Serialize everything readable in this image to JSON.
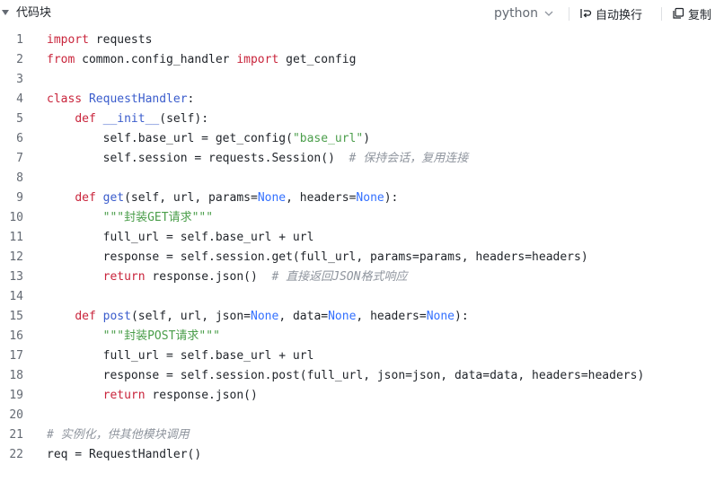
{
  "header": {
    "title": "代码块",
    "language": "python",
    "wrap_label": "自动换行",
    "copy_label": "复制"
  },
  "code": {
    "lines": [
      {
        "num": "1",
        "tokens": [
          {
            "t": "import",
            "c": "kw"
          },
          {
            "t": " requests",
            "c": ""
          }
        ]
      },
      {
        "num": "2",
        "tokens": [
          {
            "t": "from",
            "c": "kw"
          },
          {
            "t": " common.config_handler ",
            "c": ""
          },
          {
            "t": "import",
            "c": "kw"
          },
          {
            "t": " get_config",
            "c": ""
          }
        ]
      },
      {
        "num": "3",
        "tokens": []
      },
      {
        "num": "4",
        "tokens": [
          {
            "t": "class",
            "c": "kw"
          },
          {
            "t": " ",
            "c": ""
          },
          {
            "t": "RequestHandler",
            "c": "def"
          },
          {
            "t": ":",
            "c": ""
          }
        ]
      },
      {
        "num": "5",
        "tokens": [
          {
            "t": "    ",
            "c": ""
          },
          {
            "t": "def",
            "c": "kw"
          },
          {
            "t": " ",
            "c": ""
          },
          {
            "t": "__init__",
            "c": "def"
          },
          {
            "t": "(self):",
            "c": ""
          }
        ]
      },
      {
        "num": "6",
        "tokens": [
          {
            "t": "        self.base_url = get_config(",
            "c": ""
          },
          {
            "t": "\"base_url\"",
            "c": "str"
          },
          {
            "t": ")",
            "c": ""
          }
        ]
      },
      {
        "num": "7",
        "tokens": [
          {
            "t": "        self.session = requests.Session()  ",
            "c": ""
          },
          {
            "t": "# 保持会话，复用连接",
            "c": "cmt"
          }
        ]
      },
      {
        "num": "8",
        "tokens": []
      },
      {
        "num": "9",
        "tokens": [
          {
            "t": "    ",
            "c": ""
          },
          {
            "t": "def",
            "c": "kw"
          },
          {
            "t": " ",
            "c": ""
          },
          {
            "t": "get",
            "c": "def"
          },
          {
            "t": "(self, url, params=",
            "c": ""
          },
          {
            "t": "None",
            "c": "kwb"
          },
          {
            "t": ", headers=",
            "c": ""
          },
          {
            "t": "None",
            "c": "kwb"
          },
          {
            "t": "):",
            "c": ""
          }
        ]
      },
      {
        "num": "10",
        "tokens": [
          {
            "t": "        ",
            "c": ""
          },
          {
            "t": "\"\"\"封装GET请求\"\"\"",
            "c": "str"
          }
        ]
      },
      {
        "num": "11",
        "tokens": [
          {
            "t": "        full_url = self.base_url + url",
            "c": ""
          }
        ]
      },
      {
        "num": "12",
        "tokens": [
          {
            "t": "        response = self.session.get(full_url, params=params, headers=headers)",
            "c": ""
          }
        ]
      },
      {
        "num": "13",
        "tokens": [
          {
            "t": "        ",
            "c": ""
          },
          {
            "t": "return",
            "c": "kw"
          },
          {
            "t": " response.json()  ",
            "c": ""
          },
          {
            "t": "# 直接返回JSON格式响应",
            "c": "cmt"
          }
        ]
      },
      {
        "num": "14",
        "tokens": []
      },
      {
        "num": "15",
        "tokens": [
          {
            "t": "    ",
            "c": ""
          },
          {
            "t": "def",
            "c": "kw"
          },
          {
            "t": " ",
            "c": ""
          },
          {
            "t": "post",
            "c": "def"
          },
          {
            "t": "(self, url, json=",
            "c": ""
          },
          {
            "t": "None",
            "c": "kwb"
          },
          {
            "t": ", data=",
            "c": ""
          },
          {
            "t": "None",
            "c": "kwb"
          },
          {
            "t": ", headers=",
            "c": ""
          },
          {
            "t": "None",
            "c": "kwb"
          },
          {
            "t": "):",
            "c": ""
          }
        ]
      },
      {
        "num": "16",
        "tokens": [
          {
            "t": "        ",
            "c": ""
          },
          {
            "t": "\"\"\"封装POST请求\"\"\"",
            "c": "str"
          }
        ]
      },
      {
        "num": "17",
        "tokens": [
          {
            "t": "        full_url = self.base_url + url",
            "c": ""
          }
        ]
      },
      {
        "num": "18",
        "tokens": [
          {
            "t": "        response = self.session.post(full_url, json=json, data=data, headers=headers)",
            "c": ""
          }
        ]
      },
      {
        "num": "19",
        "tokens": [
          {
            "t": "        ",
            "c": ""
          },
          {
            "t": "return",
            "c": "kw"
          },
          {
            "t": " response.json()",
            "c": ""
          }
        ]
      },
      {
        "num": "20",
        "tokens": []
      },
      {
        "num": "21",
        "tokens": [
          {
            "t": "# 实例化，供其他模块调用",
            "c": "cmt"
          }
        ]
      },
      {
        "num": "22",
        "tokens": [
          {
            "t": "req = RequestHandler()",
            "c": ""
          }
        ]
      }
    ]
  }
}
